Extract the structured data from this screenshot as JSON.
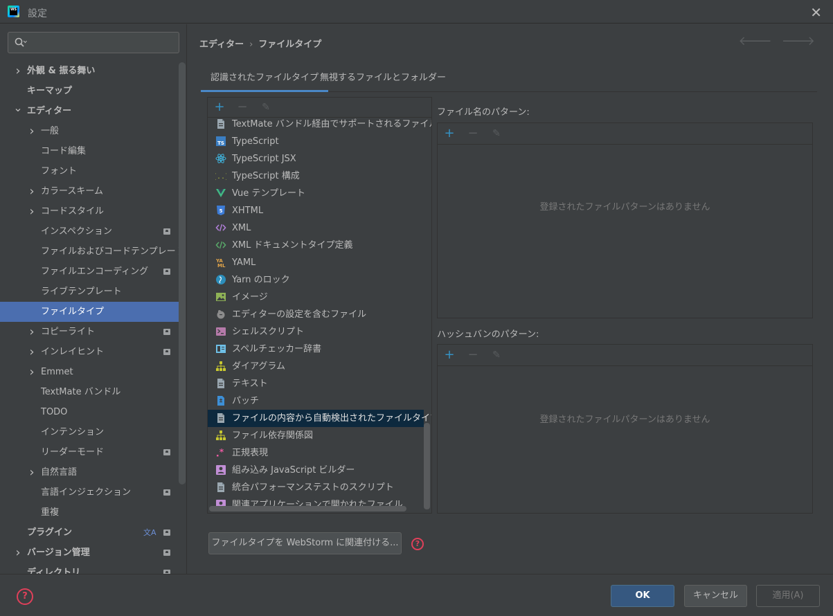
{
  "window": {
    "title": "設定"
  },
  "sidebar": {
    "items": [
      {
        "label": "外観 & 振る舞い",
        "level": 0,
        "chevron": "right",
        "bold": true
      },
      {
        "label": "キーマップ",
        "level": 0,
        "chevron": "",
        "bold": true
      },
      {
        "label": "エディター",
        "level": 0,
        "chevron": "down",
        "bold": true
      },
      {
        "label": "一般",
        "level": 1,
        "chevron": "right"
      },
      {
        "label": "コード編集",
        "level": 1,
        "chevron": ""
      },
      {
        "label": "フォント",
        "level": 1,
        "chevron": ""
      },
      {
        "label": "カラースキーム",
        "level": 1,
        "chevron": "right"
      },
      {
        "label": "コードスタイル",
        "level": 1,
        "chevron": "right"
      },
      {
        "label": "インスペクション",
        "level": 1,
        "chevron": "",
        "project_icon": true
      },
      {
        "label": "ファイルおよびコードテンプレート",
        "level": 1,
        "chevron": ""
      },
      {
        "label": "ファイルエンコーディング",
        "level": 1,
        "chevron": "",
        "project_icon": true
      },
      {
        "label": "ライブテンプレート",
        "level": 1,
        "chevron": ""
      },
      {
        "label": "ファイルタイプ",
        "level": 1,
        "chevron": "",
        "selected": true
      },
      {
        "label": "コピーライト",
        "level": 1,
        "chevron": "right",
        "project_icon": true
      },
      {
        "label": "インレイヒント",
        "level": 1,
        "chevron": "right",
        "project_icon": true
      },
      {
        "label": "Emmet",
        "level": 1,
        "chevron": "right"
      },
      {
        "label": "TextMate バンドル",
        "level": 1,
        "chevron": ""
      },
      {
        "label": "TODO",
        "level": 1,
        "chevron": ""
      },
      {
        "label": "インテンション",
        "level": 1,
        "chevron": ""
      },
      {
        "label": "リーダーモード",
        "level": 1,
        "chevron": "",
        "project_icon": true
      },
      {
        "label": "自然言語",
        "level": 1,
        "chevron": "right"
      },
      {
        "label": "言語インジェクション",
        "level": 1,
        "chevron": "",
        "project_icon": true
      },
      {
        "label": "重複",
        "level": 1,
        "chevron": ""
      },
      {
        "label": "プラグイン",
        "level": 0,
        "chevron": "",
        "bold": true,
        "project_icon": true,
        "translate_icon": true
      },
      {
        "label": "バージョン管理",
        "level": 0,
        "chevron": "right",
        "bold": true,
        "project_icon": true
      },
      {
        "label": "ディレクトリ",
        "level": 0,
        "chevron": "",
        "bold": true,
        "project_icon": true
      }
    ]
  },
  "breadcrumb": {
    "parent": "エディター",
    "separator": "›",
    "current": "ファイルタイプ"
  },
  "tabs": [
    {
      "label": "認識されたファイルタイプ",
      "active": true
    },
    {
      "label": "無視するファイルとフォルダー",
      "active": false
    }
  ],
  "toolbar": {
    "add": "+",
    "remove": "−",
    "edit": "✎"
  },
  "file_types": [
    {
      "label": "TextMate バンドル経由でサポートされるファイル",
      "icon": "text-file-icon"
    },
    {
      "label": "TypeScript",
      "icon": "typescript-icon"
    },
    {
      "label": "TypeScript JSX",
      "icon": "react-icon"
    },
    {
      "label": "TypeScript 構成",
      "icon": "ts-config-icon"
    },
    {
      "label": "Vue テンプレート",
      "icon": "vue-icon"
    },
    {
      "label": "XHTML",
      "icon": "html5-icon"
    },
    {
      "label": "XML",
      "icon": "xml-icon"
    },
    {
      "label": "XML ドキュメントタイプ定義",
      "icon": "xml-dtd-icon"
    },
    {
      "label": "YAML",
      "icon": "yaml-icon"
    },
    {
      "label": "Yarn のロック",
      "icon": "yarn-icon"
    },
    {
      "label": "イメージ",
      "icon": "image-icon"
    },
    {
      "label": "エディターの設定を含むファイル",
      "icon": "editorconfig-icon"
    },
    {
      "label": "シェルスクリプト",
      "icon": "shell-icon"
    },
    {
      "label": "スペルチェッカー辞書",
      "icon": "dictionary-icon"
    },
    {
      "label": "ダイアグラム",
      "icon": "diagram-icon"
    },
    {
      "label": "テキスト",
      "icon": "text-file-icon"
    },
    {
      "label": "パッチ",
      "icon": "patch-icon"
    },
    {
      "label": "ファイルの内容から自動検出されたファイルタイプ",
      "icon": "text-file-icon",
      "selected": true
    },
    {
      "label": "ファイル依存関係図",
      "icon": "diagram-icon"
    },
    {
      "label": "正規表現",
      "icon": "regexp-icon"
    },
    {
      "label": "組み込み JavaScript ビルダー",
      "icon": "builder-icon"
    },
    {
      "label": "統合パフォーマンステストのスクリプト",
      "icon": "text-file-icon"
    },
    {
      "label": "関連アプリケーションで開かれたファイル",
      "icon": "builder-icon"
    }
  ],
  "filename_patterns": {
    "label": "ファイル名のパターン:",
    "empty_text": "登録されたファイルパターンはありません"
  },
  "hashbang_patterns": {
    "label": "ハッシュバンのパターン:",
    "empty_text": "登録されたファイルパターンはありません"
  },
  "associate_button": "ファイルタイプを WebStorm に関連付ける...",
  "buttons": {
    "ok": "OK",
    "cancel": "キャンセル",
    "apply": "適用(A)"
  },
  "help_glyph": "?",
  "colors": {
    "accent": "#4b6eaf",
    "selection": "#0d293e",
    "ok_button": "#365880",
    "help": "#e0405a"
  }
}
